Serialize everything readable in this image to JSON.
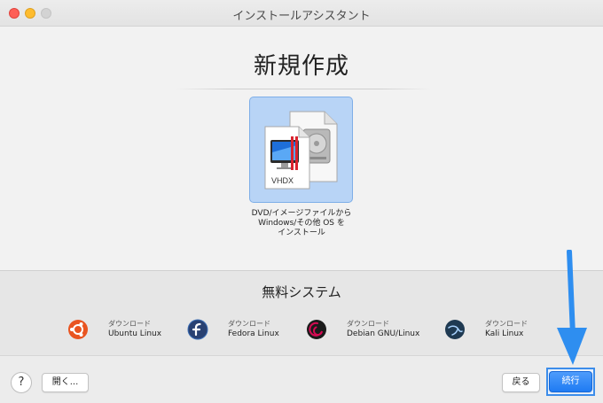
{
  "window": {
    "title": "インストールアシスタント"
  },
  "heading": "新規作成",
  "main_option": {
    "icon_label": "VHDX",
    "caption_lines": [
      "DVD/イメージファイルから",
      "Windows/その他 OS を",
      "インストール"
    ]
  },
  "free_systems": {
    "title": "無料システム",
    "items": [
      {
        "line1": "ダウンロード",
        "line2": "Ubuntu Linux",
        "icon": "ubuntu-logo-icon",
        "color": "#e95420"
      },
      {
        "line1": "ダウンロード",
        "line2": "Fedora Linux",
        "icon": "fedora-logo-icon",
        "color": "#294172"
      },
      {
        "line1": "ダウンロード",
        "line2": "Debian GNU/Linux",
        "icon": "debian-logo-icon",
        "color": "#d70a53"
      },
      {
        "line1": "ダウンロード",
        "line2": "Kali Linux",
        "icon": "kali-logo-icon",
        "color": "#367bf0"
      }
    ]
  },
  "toolbar": {
    "help_label": "?",
    "open_label": "開く...",
    "back_label": "戻る",
    "next_label": "続行"
  },
  "colors": {
    "accent": "#1f7bf3",
    "tile_selected": "#b8d4f6",
    "annotation_arrow": "#2e8ef0"
  }
}
